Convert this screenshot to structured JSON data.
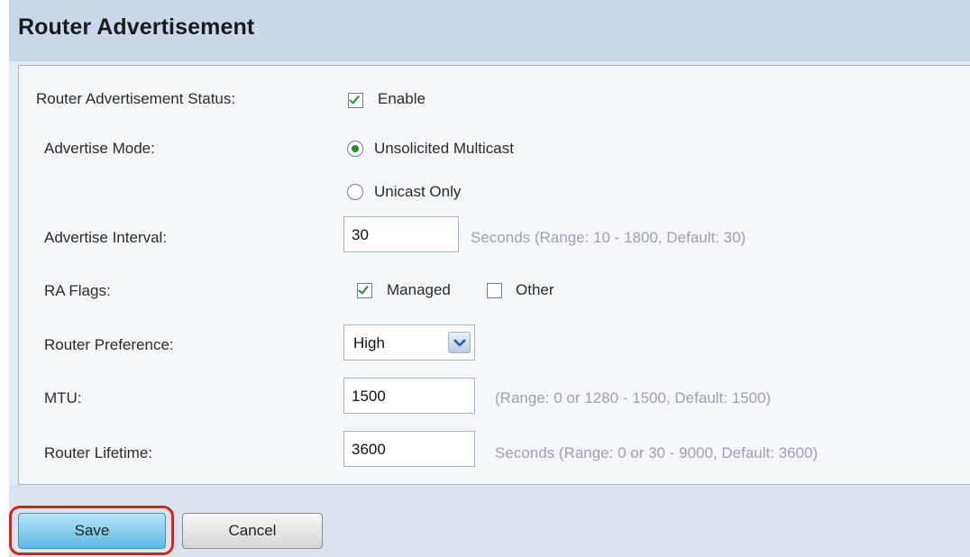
{
  "page_title": "Router Advertisement",
  "status": {
    "label": "Router Advertisement Status:",
    "enable_label": "Enable",
    "enabled": true
  },
  "advertise_mode": {
    "label": "Advertise Mode:",
    "options": [
      {
        "label": "Unsolicited Multicast",
        "selected": true
      },
      {
        "label": "Unicast Only",
        "selected": false
      }
    ]
  },
  "advertise_interval": {
    "label": "Advertise Interval:",
    "value": "30",
    "hint": "Seconds (Range: 10 - 1800, Default: 30)"
  },
  "ra_flags": {
    "label": "RA Flags:",
    "managed_label": "Managed",
    "managed_checked": true,
    "other_label": "Other",
    "other_checked": false
  },
  "router_preference": {
    "label": "Router Preference:",
    "value": "High"
  },
  "mtu": {
    "label": "MTU:",
    "value": "1500",
    "hint": "(Range: 0 or 1280 - 1500, Default: 1500)"
  },
  "router_lifetime": {
    "label": "Router Lifetime:",
    "value": "3600",
    "hint": "Seconds (Range: 0 or 30 - 9000, Default: 3600)"
  },
  "buttons": {
    "save": "Save",
    "cancel": "Cancel"
  },
  "colors": {
    "accent_check": "#2a8a2a",
    "save_highlight": "#d9221f",
    "title_bar": "#c9d9ea"
  }
}
